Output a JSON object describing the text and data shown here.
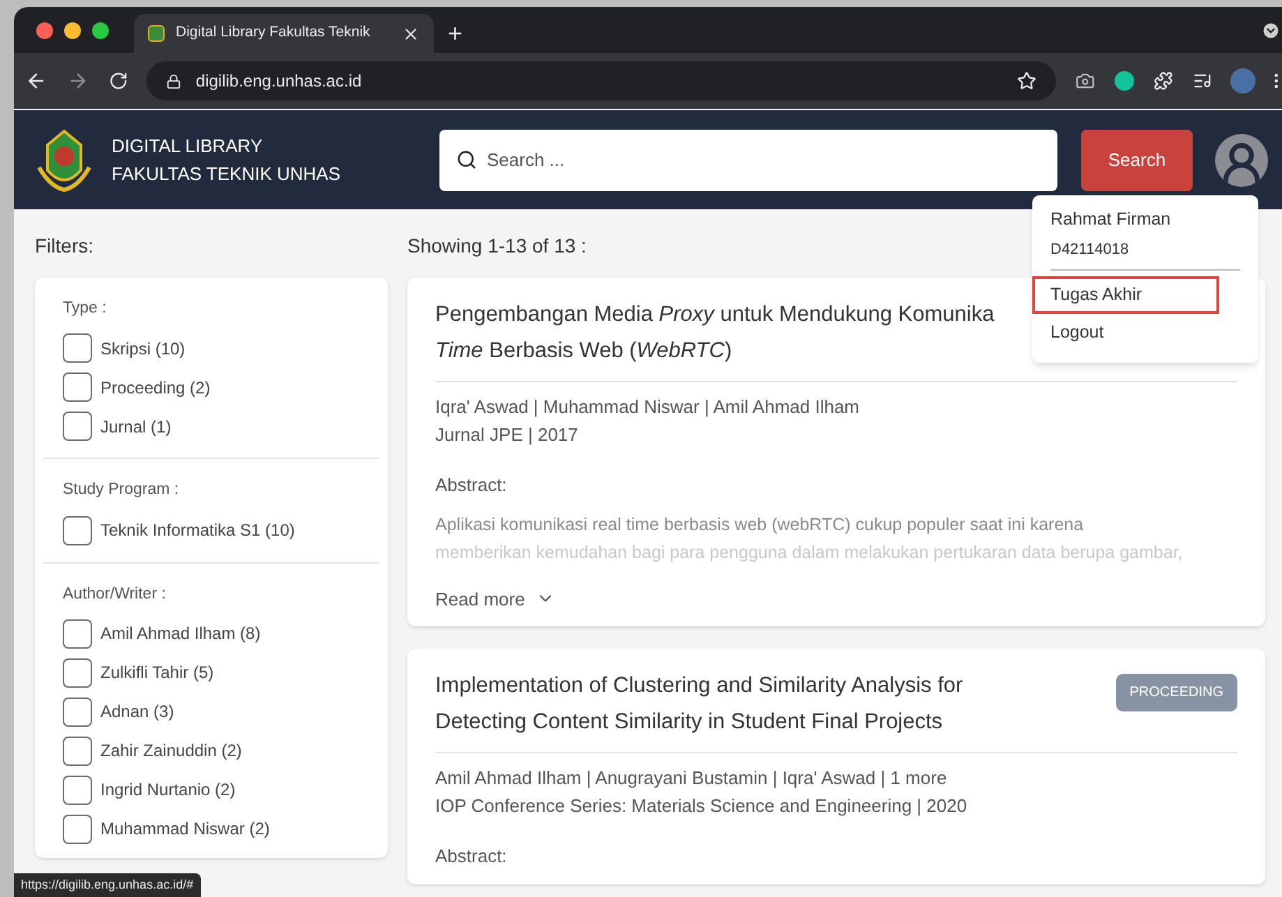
{
  "browser": {
    "tab_title": "Digital Library Fakultas Teknik",
    "new_tab": "+",
    "url": "digilib.eng.unhas.ac.id",
    "status_url": "https://digilib.eng.unhas.ac.id/#"
  },
  "header": {
    "brand_lines": [
      "DIGITAL LIBRARY",
      "FAKULTAS TEKNIK UNHAS"
    ],
    "search": {
      "placeholder": "Search ..."
    },
    "search_button": "Search"
  },
  "user_menu": {
    "name": "Rahmat Firman",
    "id": "D42114018",
    "items": [
      {
        "label": "Tugas Akhir",
        "highlighted": true
      },
      {
        "label": "Logout",
        "highlighted": false
      }
    ]
  },
  "filters": {
    "title": "Filters:",
    "groups": [
      {
        "label": "Type :",
        "options": [
          {
            "label": "Skripsi (10)",
            "checked": false
          },
          {
            "label": "Proceeding (2)",
            "checked": false
          },
          {
            "label": "Jurnal (1)",
            "checked": false
          }
        ]
      },
      {
        "label": "Study Program :",
        "options": [
          {
            "label": "Teknik Informatika S1 (10)",
            "checked": false
          }
        ]
      },
      {
        "label": "Author/Writer :",
        "options": [
          {
            "label": "Amil Ahmad Ilham (8)",
            "checked": false
          },
          {
            "label": "Zulkifli Tahir (5)",
            "checked": false
          },
          {
            "label": "Adnan (3)",
            "checked": false
          },
          {
            "label": "Zahir Zainuddin (2)",
            "checked": false
          },
          {
            "label": "Ingrid Nurtanio (2)",
            "checked": false
          },
          {
            "label": "Muhammad Niswar (2)",
            "checked": false
          }
        ]
      }
    ]
  },
  "results": {
    "summary": "Showing 1-13 of 13 :",
    "items": [
      {
        "title_lines": [
          "Pengembangan Media *Proxy* untuk Mendukung Komunika",
          "*Time* Berbasis Web (*WebRTC*)"
        ],
        "authors": "Iqra' Aswad | Muhammad Niswar | Amil Ahmad Ilham",
        "source": "Jurnal JPE | 2017",
        "abstract_label": "Abstract:",
        "abstract_lines": [
          "Aplikasi komunikasi real time berbasis web (webRTC) cukup populer saat ini karena",
          "memberikan kemudahan bagi para pengguna dalam melakukan pertukaran data berupa gambar,"
        ],
        "read_more": "Read more"
      },
      {
        "title_lines": [
          "Implementation of Clustering and Similarity Analysis for",
          "Detecting Content Similarity in Student Final Projects"
        ],
        "badge": "PROCEEDING",
        "authors": "Amil Ahmad Ilham | Anugrayani Bustamin | Iqra' Aswad | 1 more",
        "source": "IOP Conference Series: Materials Science and Engineering | 2020",
        "abstract_label": "Abstract:"
      }
    ]
  }
}
